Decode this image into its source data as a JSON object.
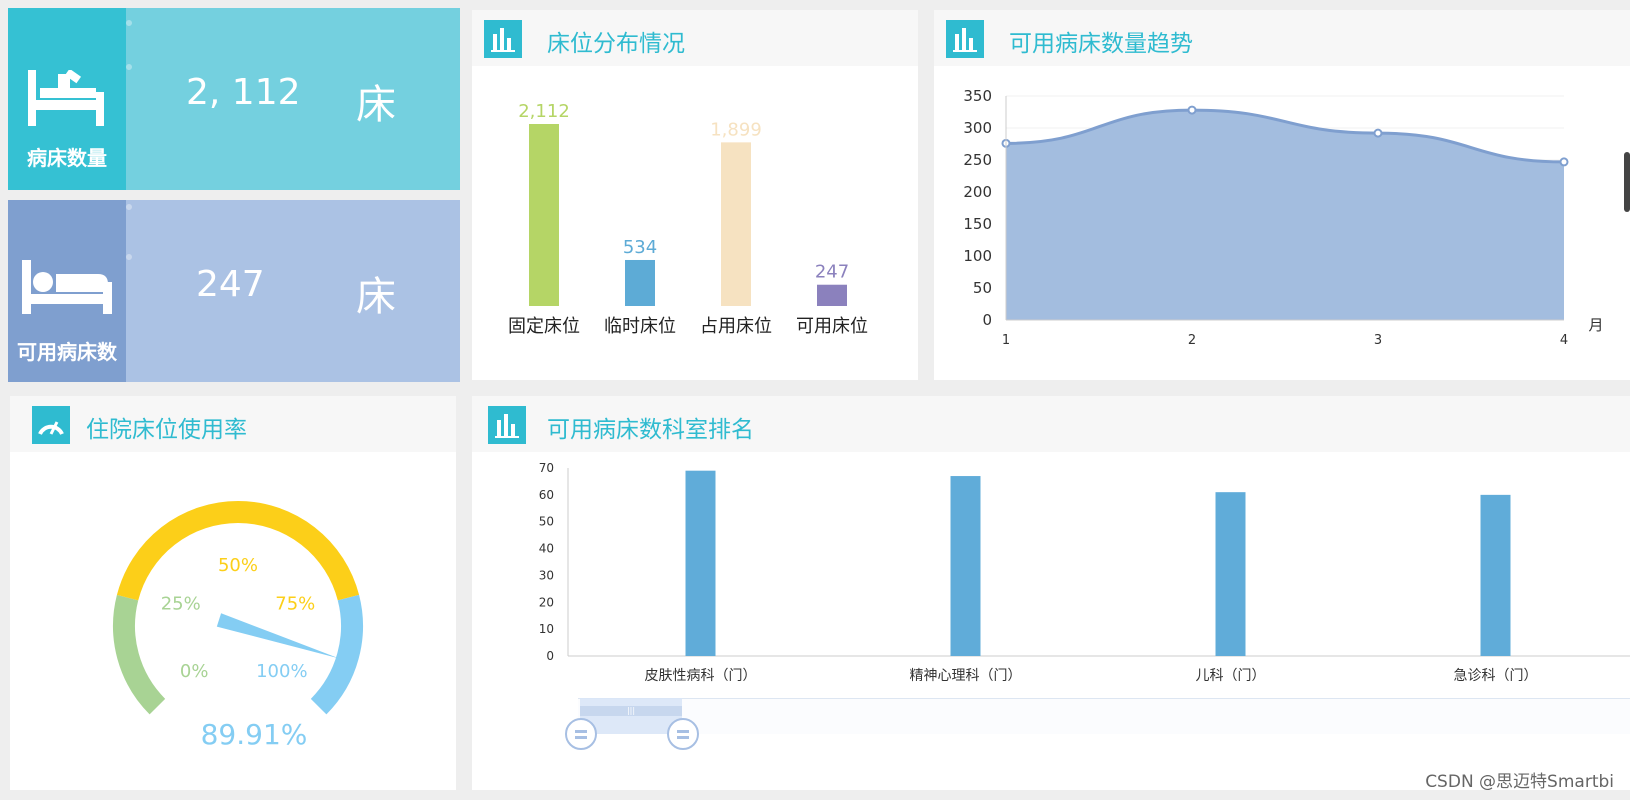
{
  "kpis": [
    {
      "label": "病床数量",
      "value": "2, 112",
      "unit": "床",
      "icon": "hospital-bed-patient-icon"
    },
    {
      "label": "可用病床数",
      "value": "247",
      "unit": "床",
      "icon": "bed-icon"
    }
  ],
  "panels": {
    "distribution": {
      "title": "床位分布情况",
      "icon": "bar-chart-icon"
    },
    "trend": {
      "title": "可用病床数量趋势",
      "icon": "bar-chart-icon"
    },
    "usage": {
      "title": "住院床位使用率",
      "icon": "gauge-icon"
    },
    "ranking": {
      "title": "可用病床数科室排名",
      "icon": "bar-chart-icon"
    }
  },
  "colors": {
    "accent": "#2fbbd0",
    "kpi1_dark": "#35c1d3",
    "kpi1_light": "#74d0df",
    "kpi2_dark": "#7f9fcf",
    "kpi2_light": "#abc2e4"
  },
  "watermark": "CSDN @思迈特Smartbi",
  "chart_data": [
    {
      "id": "distribution",
      "type": "bar",
      "categories": [
        "固定床位",
        "临时床位",
        "占用床位",
        "可用床位"
      ],
      "values": [
        2112,
        534,
        1899,
        247
      ],
      "value_labels": [
        "2,112",
        "534",
        "1,899",
        "247"
      ],
      "colors": [
        "#b5d566",
        "#5dabd6",
        "#f6e2c1",
        "#8b81bd"
      ],
      "ylim": [
        0,
        2112
      ]
    },
    {
      "id": "trend",
      "type": "area",
      "x": [
        "1",
        "2",
        "3",
        "4"
      ],
      "values": [
        276,
        328,
        292,
        247
      ],
      "xlabel": "月",
      "ylim": [
        0,
        350
      ],
      "yticks": [
        "0",
        "50",
        "100",
        "150",
        "200",
        "250",
        "300",
        "350"
      ],
      "color": "#7f9fcf"
    },
    {
      "id": "usage",
      "type": "gauge",
      "value": 89.91,
      "value_label": "89.91%",
      "range": [
        0,
        100
      ],
      "tick_labels": [
        "0%",
        "25%",
        "50%",
        "75%",
        "100%"
      ],
      "band_colors": [
        "#a8d394",
        "#fccf19",
        "#84cdf3"
      ]
    },
    {
      "id": "ranking",
      "type": "bar",
      "categories": [
        "皮肤性病科（门）",
        "精神心理科（门）",
        "儿科（门）",
        "急诊科（门）"
      ],
      "values": [
        69,
        67,
        61,
        60
      ],
      "ylim": [
        0,
        70
      ],
      "yticks": [
        "0",
        "10",
        "20",
        "30",
        "40",
        "50",
        "60",
        "70"
      ],
      "color": "#60acd9"
    }
  ]
}
